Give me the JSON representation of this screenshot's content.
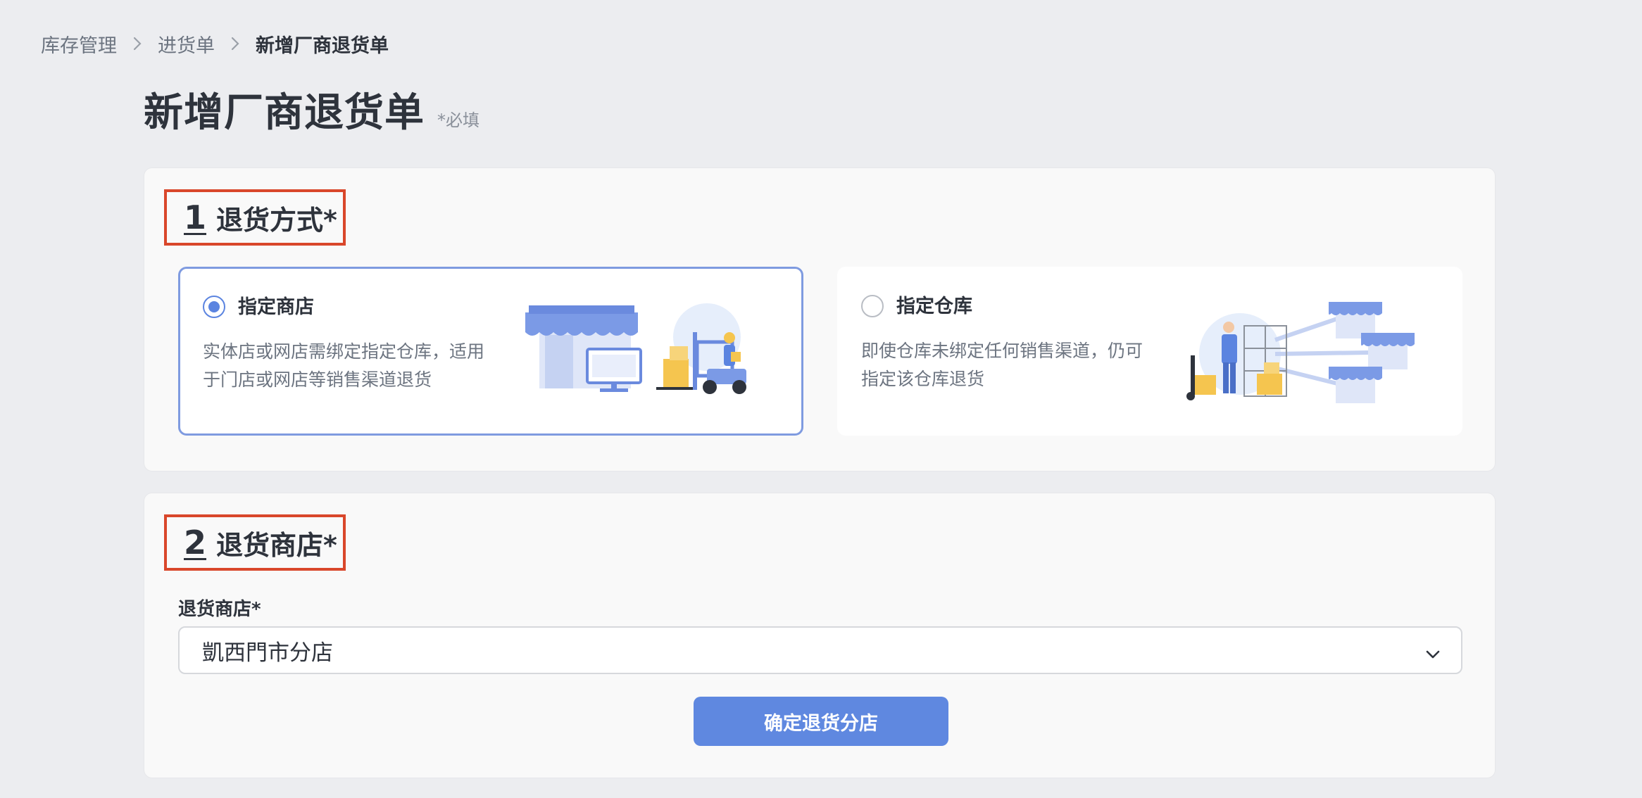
{
  "breadcrumb": {
    "items": [
      "库存管理",
      "进货单",
      "新增厂商退货单"
    ]
  },
  "header": {
    "title": "新增厂商退货单",
    "required_hint": "*必填"
  },
  "section1": {
    "number": "1",
    "title": "退货方式*",
    "options": [
      {
        "label": "指定商店",
        "description": "实体店或网店需绑定指定仓库，适用于门店或网店等销售渠道退货",
        "selected": true,
        "icon": "store-forklift-illustration"
      },
      {
        "label": "指定仓库",
        "description": "即使仓库未绑定任何销售渠道，仍可指定该仓库退货",
        "selected": false,
        "icon": "warehouse-distribution-illustration"
      }
    ]
  },
  "section2": {
    "number": "2",
    "title": "退货商店*",
    "field_label": "退货商店*",
    "selected_value": "凱西門市分店",
    "confirm_label": "确定退货分店"
  },
  "colors": {
    "accent": "#5f88e0",
    "highlight_border": "#d9472b",
    "selected_card_border": "#7f9be0",
    "illustration_blue": "#7b9ae6",
    "illustration_yellow": "#f5c54f"
  }
}
